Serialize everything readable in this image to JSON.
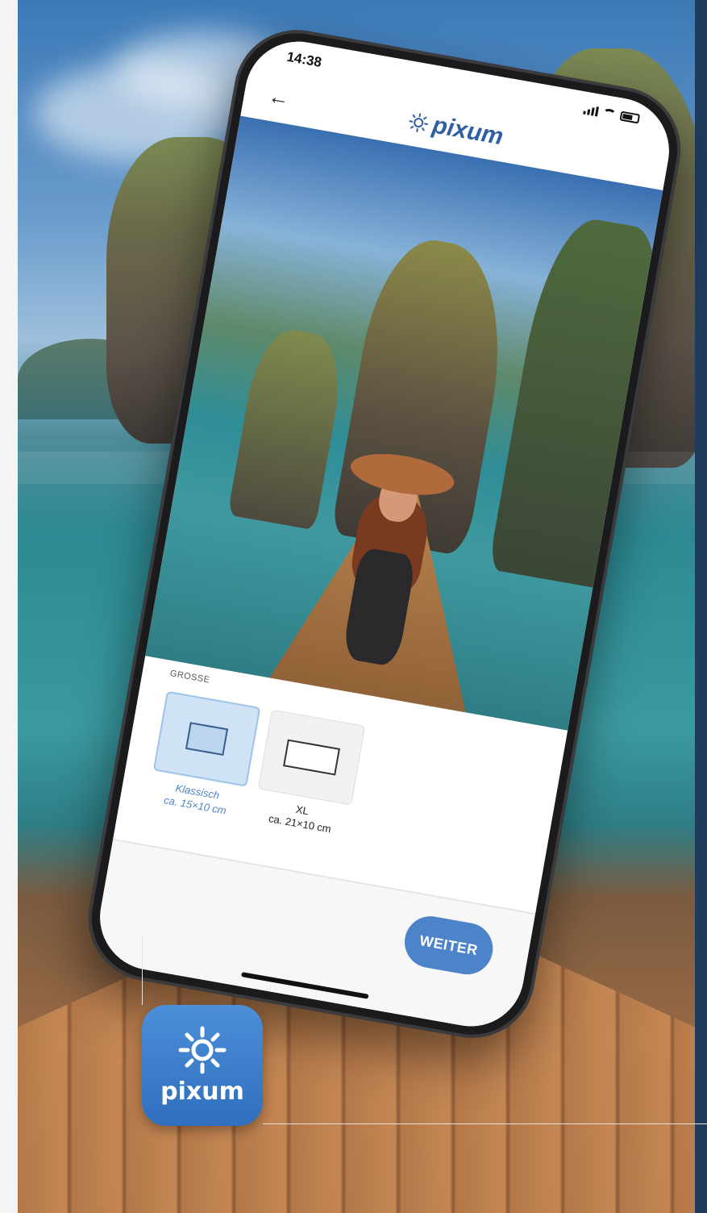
{
  "status_bar": {
    "time": "14:38"
  },
  "header": {
    "logo_text": "pixum",
    "back_icon": "arrow-left-icon"
  },
  "size_section": {
    "label": "GROSSE",
    "options": [
      {
        "name": "Klassisch",
        "dimensions": "ca. 15×10 cm",
        "selected": true
      },
      {
        "name": "XL",
        "dimensions": "ca. 21×10 cm",
        "selected": false
      }
    ]
  },
  "footer": {
    "continue_label": "WEITER"
  },
  "app_icon": {
    "text": "pixum",
    "icon": "sun-icon"
  },
  "colors": {
    "brand_blue": "#4d84c9",
    "selected_bg": "#cfe2f6",
    "logo_blue": "#2f5fa3"
  }
}
